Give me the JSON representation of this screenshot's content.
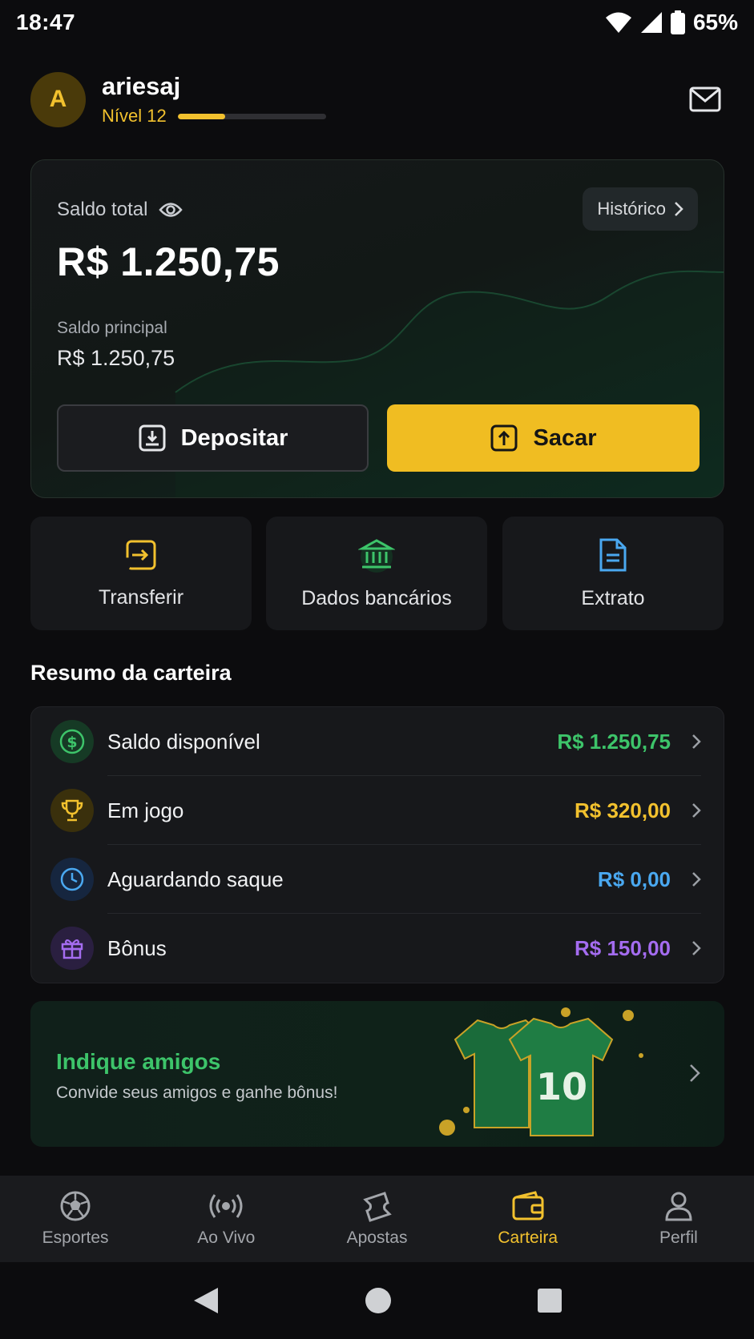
{
  "status_bar": {
    "time": "18:47",
    "battery": "65%"
  },
  "header": {
    "avatar_initial": "A",
    "username": "ariesaj",
    "level_label": "Nível 12",
    "level_progress": 0.32
  },
  "balance": {
    "label": "Saldo total",
    "history_label": "Histórico",
    "total_value": "R$ 1.250,75",
    "principal_label": "Saldo principal",
    "principal_value": "R$ 1.250,75",
    "deposit_label": "Depositar",
    "withdraw_label": "Sacar"
  },
  "quick_actions": [
    {
      "label": "Transferir",
      "icon": "transfer-icon",
      "color": "#f2c12e"
    },
    {
      "label": "Dados bancários",
      "icon": "bank-icon",
      "color": "#3dc46a"
    },
    {
      "label": "Extrato",
      "icon": "document-icon",
      "color": "#4aa8f0"
    }
  ],
  "summary": {
    "title": "Resumo da carteira",
    "rows": [
      {
        "label": "Saldo disponível",
        "value": "R$ 1.250,75",
        "color": "#3dc46a",
        "icon": "dollar-icon"
      },
      {
        "label": "Em jogo",
        "value": "R$ 320,00",
        "color": "#f2c12e",
        "icon": "trophy-icon"
      },
      {
        "label": "Aguardando saque",
        "value": "R$ 0,00",
        "color": "#4aa8f0",
        "icon": "clock-icon"
      },
      {
        "label": "Bônus",
        "value": "R$ 150,00",
        "color": "#a46cf0",
        "icon": "gift-icon"
      }
    ]
  },
  "promo": {
    "title": "Indique amigos",
    "subtitle": "Convide seus amigos e ganhe bônus!",
    "jersey_number": "10"
  },
  "bottom_nav": [
    {
      "label": "Esportes",
      "icon": "soccer-ball-icon",
      "active": false
    },
    {
      "label": "Ao Vivo",
      "icon": "live-broadcast-icon",
      "active": false
    },
    {
      "label": "Apostas",
      "icon": "ticket-icon",
      "active": false
    },
    {
      "label": "Carteira",
      "icon": "wallet-icon",
      "active": true
    },
    {
      "label": "Perfil",
      "icon": "user-icon",
      "active": false
    }
  ],
  "colors": {
    "accent": "#f2c12e",
    "background": "#0c0c0e",
    "card": "#17181b"
  }
}
